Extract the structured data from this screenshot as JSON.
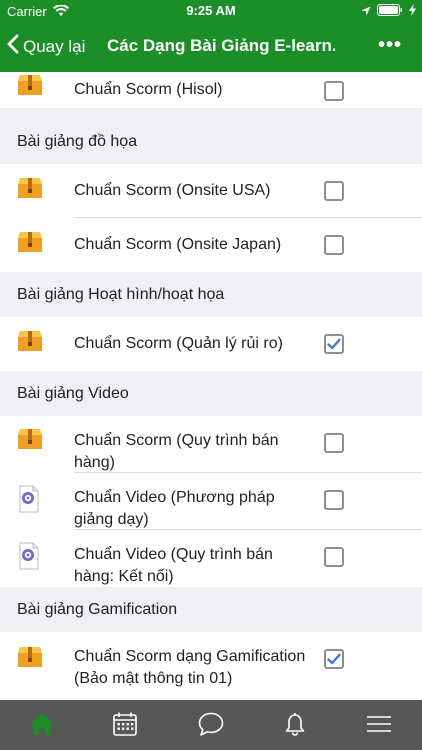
{
  "status_bar": {
    "carrier": "Carrier",
    "time": "9:25 AM"
  },
  "nav": {
    "back_label": "Quay lại",
    "title": "Các Dạng Bài Giảng E-learn...",
    "more": "•••"
  },
  "rows_top": [
    {
      "label": "Chuẩn Scorm (Hisol)",
      "icon": "package-icon",
      "checked": false
    }
  ],
  "sections": [
    {
      "title": "Bài giảng đồ họa",
      "items": [
        {
          "label": "Chuẩn Scorm (Onsite USA)",
          "icon": "package-icon",
          "checked": false
        },
        {
          "label": "Chuẩn Scorm (Onsite Japan)",
          "icon": "package-icon",
          "checked": false
        }
      ]
    },
    {
      "title": "Bài giảng Hoạt hình/hoạt họa",
      "items": [
        {
          "label": "Chuẩn Scorm (Quản lý rủi ro)",
          "icon": "package-icon",
          "checked": true
        }
      ]
    },
    {
      "title": "Bài giảng Video",
      "items": [
        {
          "label": "Chuẩn Scorm (Quy trình bán hàng)",
          "icon": "package-icon",
          "checked": false
        },
        {
          "label": "Chuẩn Video (Phương pháp giảng dạy)",
          "icon": "video-file-icon",
          "checked": false
        },
        {
          "label": "Chuẩn Video (Quy trình bán hàng: Kết nối)",
          "icon": "video-file-icon",
          "checked": false
        }
      ]
    },
    {
      "title": "Bài giảng Gamification",
      "items": [
        {
          "label": "Chuẩn Scorm dạng Gamification (Bảo mật thông tin 01)",
          "icon": "package-icon",
          "checked": true
        }
      ]
    }
  ],
  "tab_bar": {
    "items": [
      "home-icon",
      "calendar-icon",
      "chat-icon",
      "bell-icon",
      "menu-icon"
    ],
    "active_color": "#1c8e28",
    "inactive_color": "#ffffff"
  },
  "colors": {
    "brand": "#1c8e28",
    "check": "#3b7be0",
    "package": "#f0a020"
  }
}
